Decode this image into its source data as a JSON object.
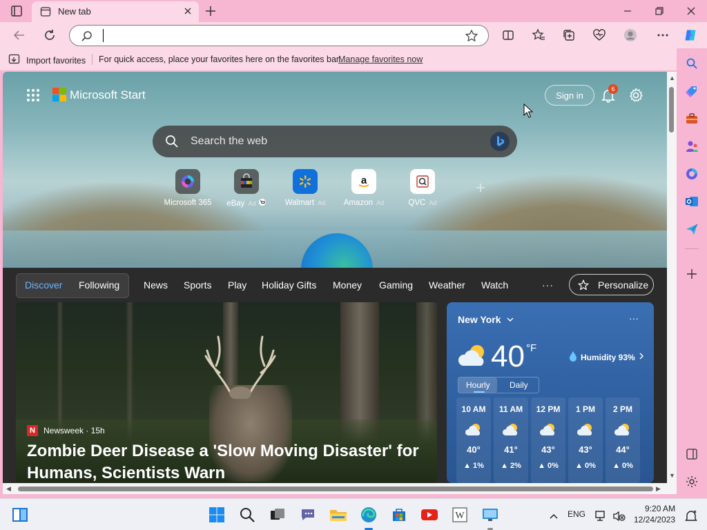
{
  "browser": {
    "tab_title": "New tab",
    "address_value": "",
    "favorites": {
      "import_label": "Import favorites",
      "message": "For quick access, place your favorites here on the favorites bar.",
      "manage_link": "Manage favorites now"
    }
  },
  "start": {
    "brand": "Microsoft Start",
    "sign_in": "Sign in",
    "notification_count": "6",
    "search_placeholder": "Search the web",
    "quick_links": [
      {
        "label": "Microsoft 365",
        "ad": ""
      },
      {
        "label": "eBay",
        "ad": "Ad"
      },
      {
        "label": "Walmart",
        "ad": "Ad"
      },
      {
        "label": "Amazon",
        "ad": "Ad"
      },
      {
        "label": "QVC",
        "ad": "Ad"
      }
    ]
  },
  "feed": {
    "nav": [
      "Discover",
      "Following",
      "News",
      "Sports",
      "Play",
      "Holiday Gifts",
      "Money",
      "Gaming",
      "Weather",
      "Watch"
    ],
    "more": "···",
    "personalize": "Personalize",
    "story": {
      "source": "Newsweek · 15h",
      "source_mark": "N",
      "headline": "Zombie Deer Disease a 'Slow Moving Disaster' for Humans, Scientists Warn"
    }
  },
  "weather": {
    "city": "New York",
    "temp": "40",
    "unit": "°F",
    "humidity": "Humidity 93%",
    "tabs": [
      "Hourly",
      "Daily"
    ],
    "hours": [
      {
        "time": "10 AM",
        "temp": "40°",
        "precip": "1%"
      },
      {
        "time": "11 AM",
        "temp": "41°",
        "precip": "2%"
      },
      {
        "time": "12 PM",
        "temp": "43°",
        "precip": "0%"
      },
      {
        "time": "1 PM",
        "temp": "43°",
        "precip": "0%"
      },
      {
        "time": "2 PM",
        "temp": "44°",
        "precip": "0%"
      }
    ]
  },
  "taskbar": {
    "lang": "ENG",
    "time": "9:20 AM",
    "date": "12/24/2023"
  },
  "colors": {
    "chrome_pink": "#f7b6d2",
    "accent_blue": "#6ab7ff",
    "weather_blue": "#3a6fb3"
  }
}
